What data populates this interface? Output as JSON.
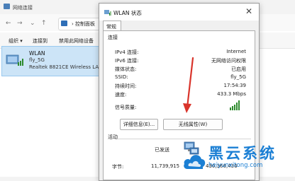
{
  "background_window": {
    "title": "网络连接",
    "address": "控制面板",
    "commands": [
      "组织 ▾",
      "连接到",
      "禁用此网络设备"
    ],
    "adapter": {
      "name": "WLAN",
      "ssid": "fly_5G",
      "device": "Realtek 8821CE Wireless LAN ..."
    }
  },
  "dialog": {
    "title": "WLAN 状态",
    "tab": "常规",
    "connection_section": "连接",
    "rows": [
      {
        "label": "IPv4 连接:",
        "value": "Internet"
      },
      {
        "label": "IPv6 连接:",
        "value": "无网络访问权限"
      },
      {
        "label": "媒体状态:",
        "value": "已启用"
      },
      {
        "label": "SSID:",
        "value": "fly_5G"
      },
      {
        "label": "持续时间:",
        "value": "17:54:39"
      },
      {
        "label": "速度:",
        "value": "433.3 Mbps"
      }
    ],
    "signal_label": "信号质量:",
    "buttons": {
      "details": "详细信息(E)...",
      "wireless_props": "无线属性(W)"
    },
    "activity_section": "活动",
    "sent_label": "已发送",
    "bytes_label": "字节:",
    "sent_bytes": "11,739,915",
    "received_bytes": "430,366,436"
  },
  "watermark": {
    "title": "黑云系统",
    "url": "heiyunxitong.com"
  },
  "colors": {
    "accent": "#1b7fd4",
    "arrow": "#d9342b",
    "signal": "#2e8b2e"
  }
}
